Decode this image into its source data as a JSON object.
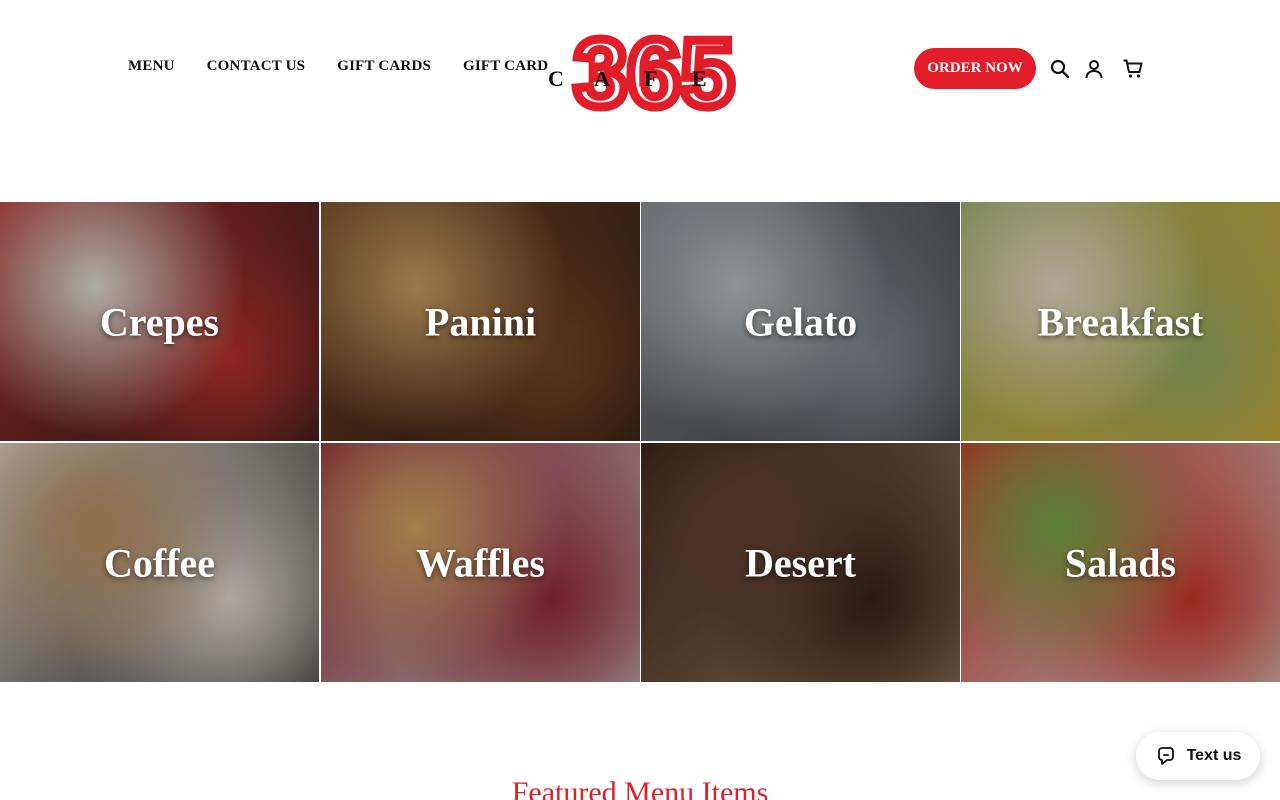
{
  "nav": {
    "items": [
      {
        "label": "MENU"
      },
      {
        "label": "CONTACT US"
      },
      {
        "label": "GIFT CARDS"
      },
      {
        "label": "GIFT CARD"
      }
    ]
  },
  "logo": {
    "letters": [
      "C",
      "A",
      "F",
      "E"
    ],
    "digits": "365",
    "brand_color": "#e11d2a"
  },
  "header_actions": {
    "order_label": "ORDER NOW",
    "icons": [
      "search-icon",
      "account-icon",
      "cart-icon"
    ]
  },
  "categories": [
    {
      "label": "Crepes",
      "colors": [
        "#f3efe6",
        "#c4352e",
        "#1b1b1b"
      ]
    },
    {
      "label": "Panini",
      "colors": [
        "#d9a86a",
        "#7a4a26",
        "#2a1a12"
      ]
    },
    {
      "label": "Gelato",
      "colors": [
        "#c9cdd1",
        "#8a8f96",
        "#3b3d40"
      ]
    },
    {
      "label": "Breakfast",
      "colors": [
        "#f2ead2",
        "#9fb66a",
        "#e6b52c"
      ]
    },
    {
      "label": "Coffee",
      "colors": [
        "#c99a67",
        "#f0e9df",
        "#2f2a27"
      ]
    },
    {
      "label": "Waffles",
      "colors": [
        "#e0b068",
        "#9c2b3e",
        "#d9d4cf"
      ]
    },
    {
      "label": "Desert",
      "colors": [
        "#6b4532",
        "#3a2419",
        "#a9886a"
      ]
    },
    {
      "label": "Salads",
      "colors": [
        "#7fb24a",
        "#d83a2e",
        "#e8e6e0"
      ]
    }
  ],
  "featured": {
    "title": "Featured Menu Items"
  },
  "text_widget": {
    "label": "Text us"
  },
  "colors": {
    "accent": "#e11d2a",
    "text": "#111111"
  }
}
